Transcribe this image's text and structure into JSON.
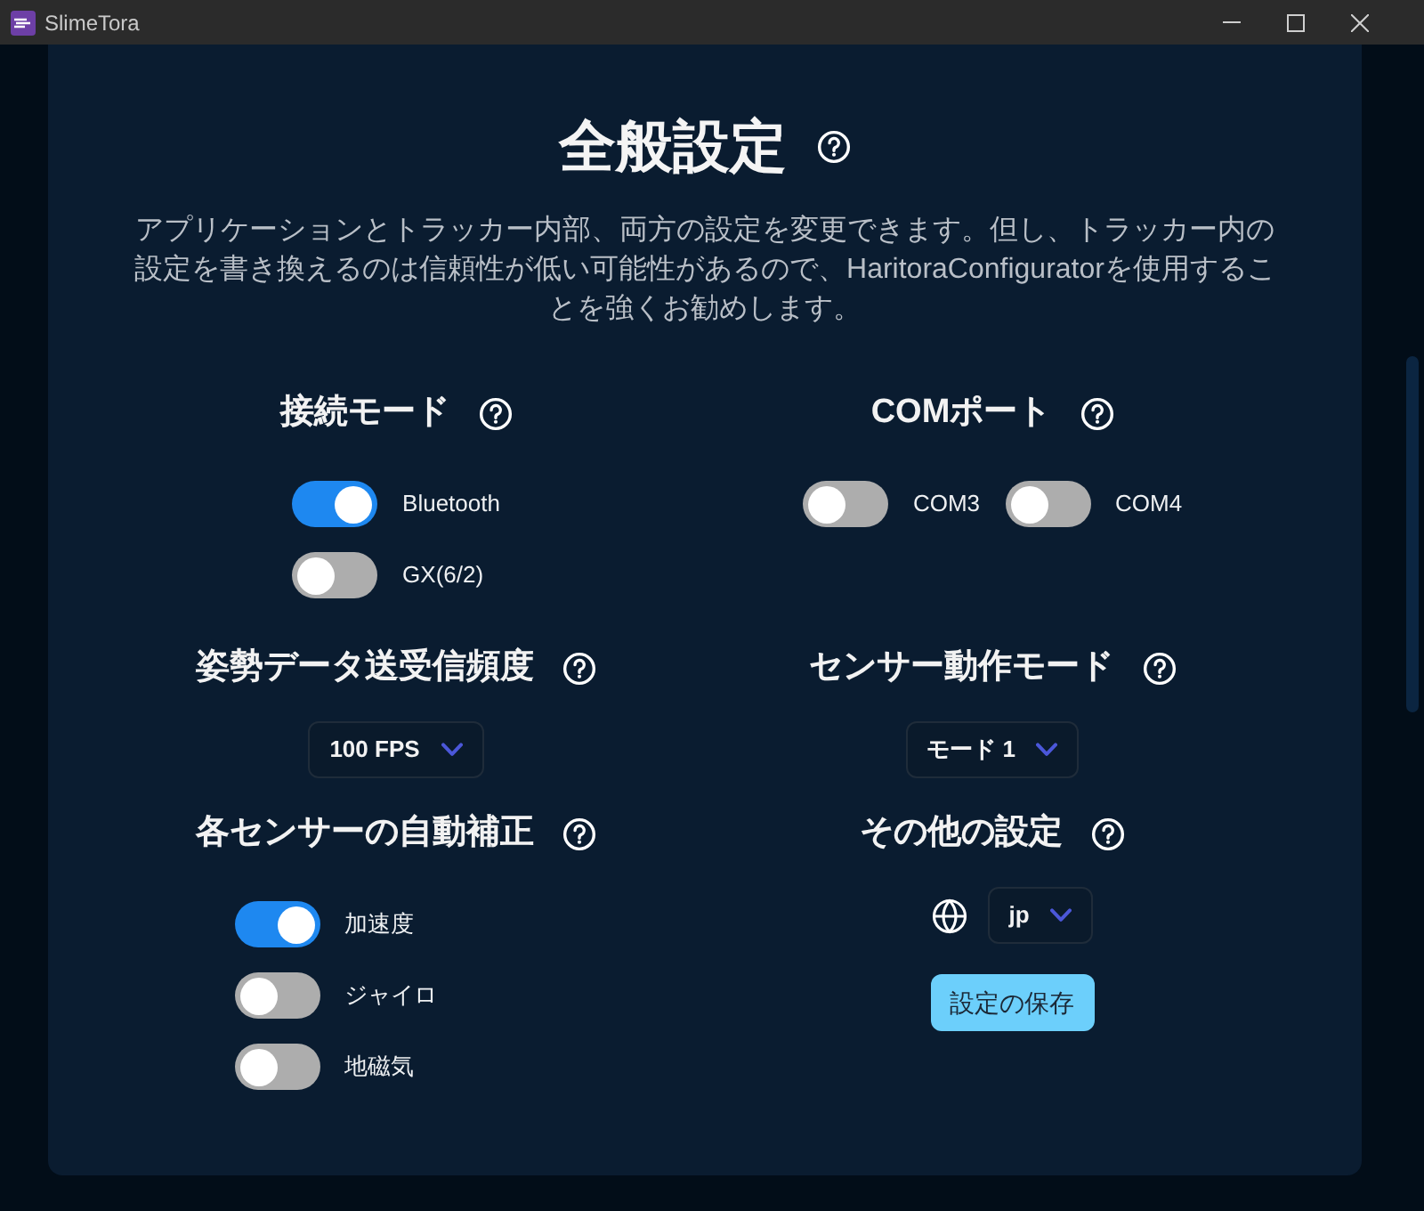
{
  "window": {
    "title": "SlimeTora"
  },
  "page": {
    "title": "全般設定",
    "description": "アプリケーションとトラッカー内部、両方の設定を変更できます。但し、トラッカー内の設定を書き換えるのは信頼性が低い可能性があるので、HaritoraConfiguratorを使用することを強くお勧めします。"
  },
  "sections": [
    {
      "kind": "toggle_column",
      "title": "接続モード",
      "toggles": [
        {
          "label": "Bluetooth",
          "on": true
        },
        {
          "label": "GX(6/2)",
          "on": false
        }
      ]
    },
    {
      "kind": "toggle_row",
      "title": "COMポート",
      "toggles": [
        {
          "label": "COM3",
          "on": false
        },
        {
          "label": "COM4",
          "on": false
        }
      ]
    },
    {
      "kind": "select",
      "title": "姿勢データ送受信頻度",
      "value": "100 FPS"
    },
    {
      "kind": "select",
      "title": "センサー動作モード",
      "value": "モード 1"
    },
    {
      "kind": "toggle_column",
      "title": "各センサーの自動補正",
      "toggles": [
        {
          "label": "加速度",
          "on": true
        },
        {
          "label": "ジャイロ",
          "on": false
        },
        {
          "label": "地磁気",
          "on": false
        }
      ]
    },
    {
      "kind": "language_and_save",
      "title": "その他の設定",
      "language": "jp",
      "save_button": "設定の保存"
    }
  ]
}
